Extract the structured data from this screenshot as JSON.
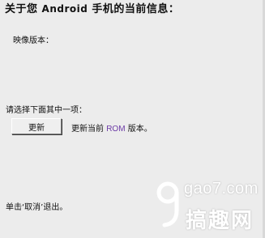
{
  "header": {
    "title_prefix": "关于您 ",
    "title_brand": "Android",
    "title_suffix": " 手机的当前信息："
  },
  "info": {
    "image_version_label": "映像版本："
  },
  "options": {
    "choose_label": "请选择下面其中一项：",
    "update_button_label": "更新",
    "update_desc_prefix": "更新当前 ",
    "update_desc_rom": "ROM",
    "update_desc_suffix": " 版本。"
  },
  "footer": {
    "text": "单击‘取消’退出。"
  },
  "watermark": {
    "url": "gao7.com",
    "name": "搞趣网",
    "logo_icon": "g-logo-icon"
  },
  "colors": {
    "background": "#ececec",
    "rom_accent": "#6b3aa6"
  }
}
